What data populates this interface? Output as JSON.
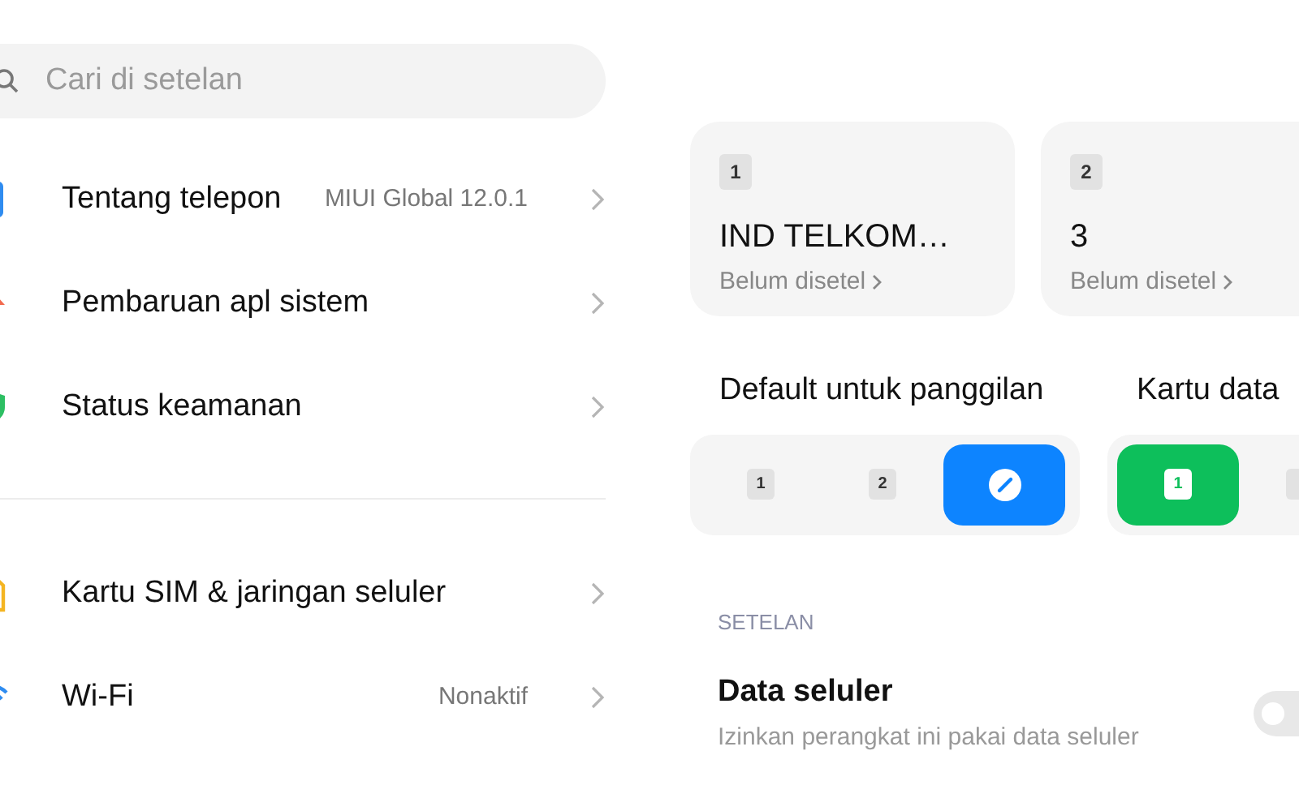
{
  "search": {
    "placeholder": "Cari di setelan"
  },
  "settings_groups": [
    {
      "items": [
        {
          "kind": "phone",
          "label": "Tentang telepon",
          "value": "MIUI Global 12.0.1"
        },
        {
          "kind": "update",
          "label": "Pembaruan apl sistem"
        },
        {
          "kind": "shield",
          "label": "Status keamanan"
        }
      ]
    },
    {
      "items": [
        {
          "kind": "sim",
          "label": "Kartu SIM & jaringan seluler"
        },
        {
          "kind": "wifi",
          "label": "Wi-Fi",
          "value": "Nonaktif"
        }
      ]
    }
  ],
  "sim_cards": [
    {
      "slot": "1",
      "name": "IND TELKOM…",
      "status": "Belum disetel"
    },
    {
      "slot": "2",
      "name": "3",
      "status": "Belum disetel"
    }
  ],
  "defaults": [
    {
      "title": "Default untuk panggilan",
      "color": "#0d84ff",
      "options": [
        {
          "kind": "sim",
          "label": "1",
          "selected": false
        },
        {
          "kind": "sim",
          "label": "2",
          "selected": false
        },
        {
          "kind": "edit",
          "selected": true
        }
      ]
    },
    {
      "title": "Kartu data",
      "color": "#0dbf5b",
      "options": [
        {
          "kind": "sim",
          "label": "1",
          "selected": true
        },
        {
          "kind": "sim",
          "selected": false
        }
      ]
    }
  ],
  "section_header": "SETELAN",
  "mobile_data": {
    "title": "Data seluler",
    "subtitle": "Izinkan perangkat ini pakai data seluler",
    "on": false
  }
}
